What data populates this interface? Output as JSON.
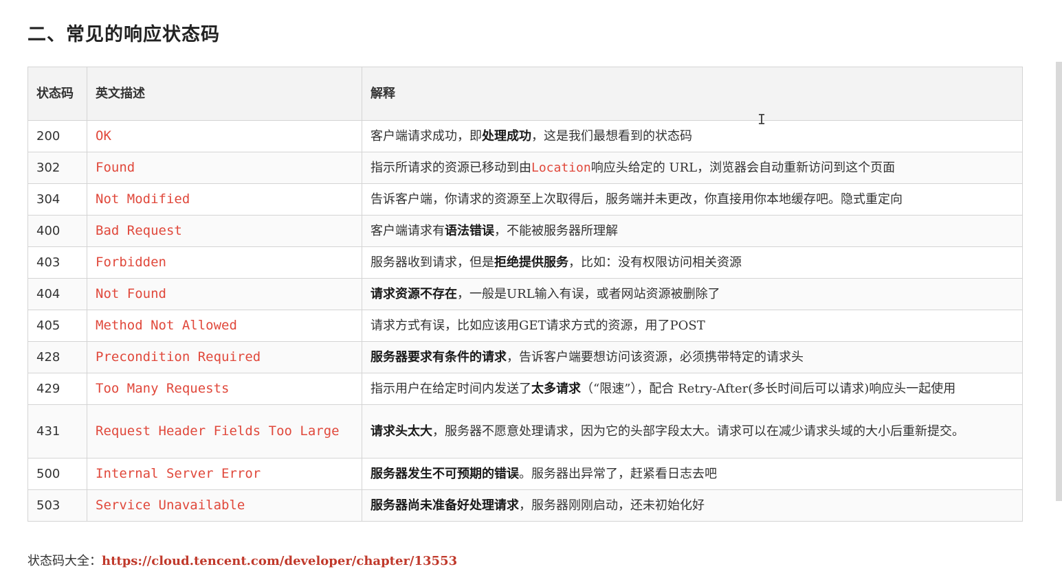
{
  "heading": "二、常见的响应状态码",
  "table": {
    "headers": [
      "状态码",
      "英文描述",
      "解释"
    ],
    "rows": [
      {
        "code": "200",
        "name": "OK",
        "desc": [
          {
            "t": "客户端请求成功，即"
          },
          {
            "t": "处理成功",
            "b": true
          },
          {
            "t": "，这是我们最想看到的状态码"
          }
        ]
      },
      {
        "code": "302",
        "name": "Found",
        "desc": [
          {
            "t": "指示所请求的资源已移动到由"
          },
          {
            "t": "Location",
            "m": true
          },
          {
            "t": "响应头给定的 URL，浏览器会自动重新访问到这个页面"
          }
        ]
      },
      {
        "code": "304",
        "name": "Not Modified",
        "desc": [
          {
            "t": "告诉客户端，你请求的资源至上次取得后，服务端并未更改，你直接用你本地缓存吧。隐式重定向"
          }
        ]
      },
      {
        "code": "400",
        "name": "Bad Request",
        "desc": [
          {
            "t": "客户端请求有"
          },
          {
            "t": "语法错误",
            "b": true
          },
          {
            "t": "，不能被服务器所理解"
          }
        ]
      },
      {
        "code": "403",
        "name": "Forbidden",
        "desc": [
          {
            "t": "服务器收到请求，但是"
          },
          {
            "t": "拒绝提供服务",
            "b": true
          },
          {
            "t": "，比如：没有权限访问相关资源"
          }
        ]
      },
      {
        "code": "404",
        "name": "Not Found",
        "desc": [
          {
            "t": "请求资源不存在",
            "b": true
          },
          {
            "t": "，一般是URL输入有误，或者网站资源被删除了"
          }
        ]
      },
      {
        "code": "405",
        "name": "Method Not Allowed",
        "desc": [
          {
            "t": "请求方式有误，比如应该用GET请求方式的资源，用了POST"
          }
        ]
      },
      {
        "code": "428",
        "name": "Precondition Required",
        "desc": [
          {
            "t": "服务器要求有条件的请求",
            "b": true
          },
          {
            "t": "，告诉客户端要想访问该资源，必须携带特定的请求头"
          }
        ]
      },
      {
        "code": "429",
        "name": "Too Many Requests",
        "desc": [
          {
            "t": "指示用户在给定时间内发送了"
          },
          {
            "t": "太多请求",
            "b": true
          },
          {
            "t": "（“限速”），配合 Retry-After(多长时间后可以请求)响应头一起使用"
          }
        ]
      },
      {
        "code": "431",
        "name": "Request Header Fields Too Large",
        "tall": true,
        "desc": [
          {
            "t": "请求头太大",
            "b": true
          },
          {
            "t": "，服务器不愿意处理请求，因为它的头部字段太大。请求可以在减少请求头域的大小后重新提交。"
          }
        ]
      },
      {
        "code": "500",
        "name": "Internal Server Error",
        "desc": [
          {
            "t": "服务器发生不可预期的错误",
            "b": true
          },
          {
            "t": "。服务器出异常了，赶紧看日志去吧"
          }
        ]
      },
      {
        "code": "503",
        "name": "Service Unavailable",
        "desc": [
          {
            "t": "服务器尚未准备好处理请求",
            "b": true
          },
          {
            "t": "，服务器刚刚启动，还未初始化好"
          }
        ]
      }
    ]
  },
  "footer": {
    "label": "状态码大全：",
    "link": "https://cloud.tencent.com/developer/chapter/13553"
  },
  "cursor": "I"
}
